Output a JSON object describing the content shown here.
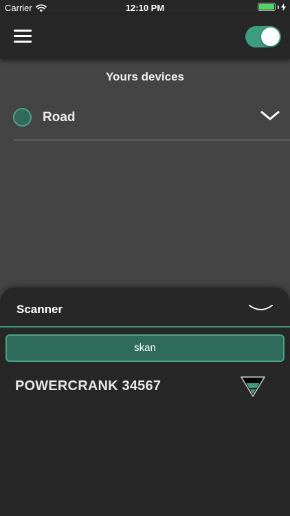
{
  "status_bar": {
    "carrier": "Carrier",
    "time": "12:10 PM",
    "battery_level": 1.0
  },
  "nav": {
    "menu_icon": "hamburger-menu-icon",
    "toggle_on": true,
    "accent_color": "#3b9c7e"
  },
  "devices": {
    "title": "Yours devices",
    "items": [
      {
        "name": "Road",
        "icon": "status-dot-icon",
        "expand_icon": "chevron-down-icon"
      }
    ]
  },
  "scanner": {
    "title": "Scanner",
    "collapse_icon": "chevron-down-icon",
    "scan_button_label": "skan",
    "results": [
      {
        "name": "POWERCRANK 34567",
        "icon": "signal-strength-icon"
      }
    ]
  },
  "colors": {
    "background": "#444444",
    "bar": "#272727",
    "accent": "#3b9c7e",
    "accent_dark": "#2e6b5b"
  }
}
